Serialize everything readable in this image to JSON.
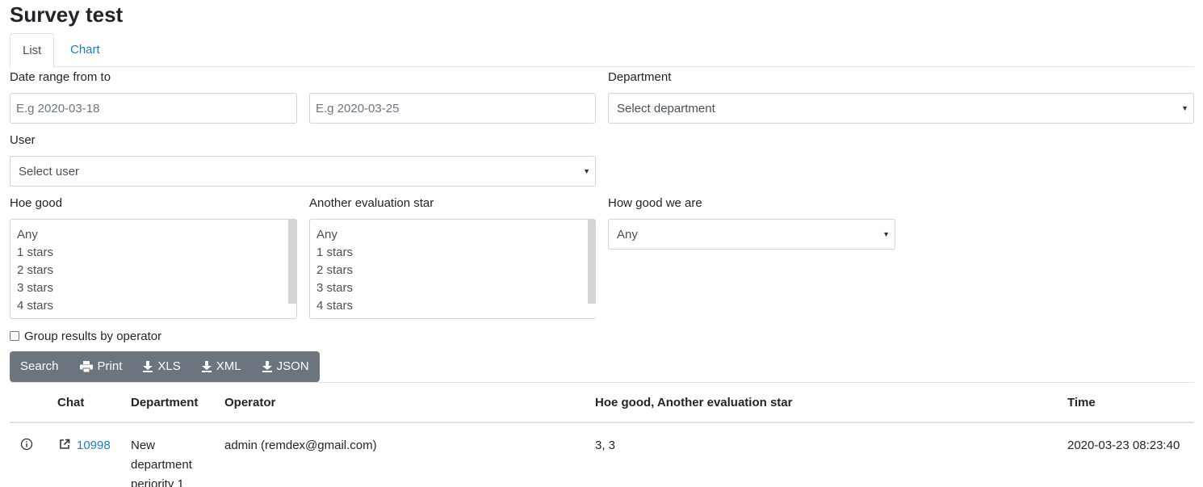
{
  "page": {
    "title": "Survey test"
  },
  "tabs": [
    {
      "label": "List",
      "active": true
    },
    {
      "label": "Chart",
      "active": false
    }
  ],
  "filters": {
    "date_range_label": "Date range from to",
    "date_from_placeholder": "E.g 2020-03-18",
    "date_to_placeholder": "E.g 2020-03-25",
    "department_label": "Department",
    "department_value": "Select department",
    "user_label": "User",
    "user_value": "Select user",
    "hoe_good_label": "Hoe good",
    "hoe_good_options": [
      "Any",
      "1 stars",
      "2 stars",
      "3 stars",
      "4 stars"
    ],
    "another_eval_label": "Another evaluation star",
    "another_eval_options": [
      "Any",
      "1 stars",
      "2 stars",
      "3 stars",
      "4 stars"
    ],
    "how_good_label": "How good we are",
    "how_good_value": "Any",
    "group_by_operator_label": "Group results by operator",
    "group_by_operator_checked": false
  },
  "actions": {
    "search": "Search",
    "print": "Print",
    "xls": "XLS",
    "xml": "XML",
    "json": "JSON"
  },
  "table": {
    "headers": {
      "chat": "Chat",
      "department": "Department",
      "operator": "Operator",
      "evaluation": "Hoe good, Another evaluation star",
      "time": "Time"
    },
    "rows": [
      {
        "chat_id": "10998",
        "department_lines": [
          "New",
          "department",
          "periority 1"
        ],
        "operator": "admin (remdex@gmail.com)",
        "evaluation": "3, 3",
        "time": "2020-03-23 08:23:40"
      }
    ]
  },
  "colors": {
    "link": "#1a7fc1",
    "button_bg": "#6c757d",
    "border": "#ced4da"
  },
  "icons": {
    "info": "info-circle-icon",
    "open_external": "external-link-icon",
    "print": "printer-icon",
    "download": "download-icon",
    "caret": "caret-down-icon"
  }
}
